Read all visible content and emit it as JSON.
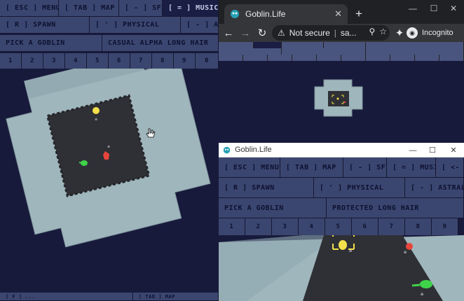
{
  "left_game": {
    "menu_row1": [
      "[ ESC ] MENU",
      "[ TAB ] MAP",
      "[ - ] SFX",
      "[ = ] MUSIC"
    ],
    "menu_row2": [
      "[ R ] SPAWN",
      "[ ' ] PHYSICAL",
      "[ - ] ASTRA"
    ],
    "menu_row3": [
      "PICK A GOBLIN",
      "CASUAL ALPHA LONG HAIR"
    ],
    "numbers": [
      "1",
      "2",
      "3",
      "4",
      "5",
      "6",
      "7",
      "8",
      "9",
      "0"
    ],
    "bottom_bar": [
      "[ F ] ...",
      "[ TAB ] MAP"
    ]
  },
  "browser": {
    "tab_title": "Goblin.Life",
    "omnibox_warning": "Not secure",
    "omnibox_url": "sa...",
    "profile_label": "Incognito",
    "colors": {
      "tab_bg": "#35363a",
      "frame_bg": "#202124"
    }
  },
  "window2": {
    "title": "Goblin.Life",
    "menu_row1": [
      "[ ESC ] MENU",
      "[ TAB ] MAP",
      "[ - ] SFX",
      "[ = ] MUSIC",
      "[ <- ]"
    ],
    "menu_row2": [
      "[ R ] SPAWN",
      "[ ' ] PHYSICAL",
      "[ - ] ASTRAL"
    ],
    "menu_row3": [
      "PICK A GOBLIN",
      "PROTECTED LONG HAIR"
    ],
    "numbers": [
      "1",
      "2",
      "3",
      "4",
      "5",
      "6",
      "7",
      "8",
      "9"
    ]
  },
  "colors": {
    "background": "#181a3c",
    "menu_cell": "#3b4670",
    "active_cell": "#1a1d44",
    "room_floor": "#9fb6bd",
    "dark_floor": "#2f3035",
    "goblin_yellow": "#f4e04a",
    "goblin_red": "#e8453c",
    "goblin_green": "#3fd24a"
  }
}
